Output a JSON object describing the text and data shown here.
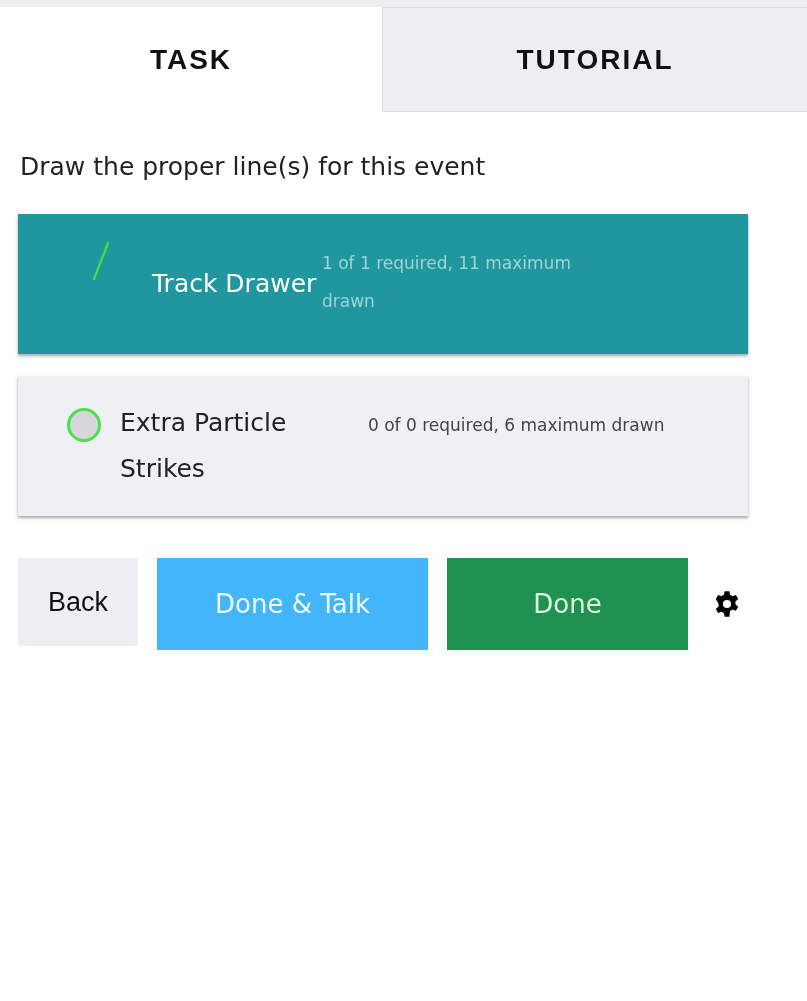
{
  "tabs": [
    {
      "label": "TASK",
      "selected": true
    },
    {
      "label": "TUTORIAL",
      "selected": false
    }
  ],
  "instruction": "Draw the proper line(s) for this event",
  "tools": [
    {
      "kind": "line",
      "label": "Track Drawer",
      "details": "1 of 1 required, 11 maximum drawn",
      "selected": true,
      "color": "#3ee13e"
    },
    {
      "kind": "point",
      "label": "Extra Particle Strikes",
      "details": "0 of 0 required, 6 maximum drawn",
      "selected": false,
      "color": "#4be04b"
    }
  ],
  "buttons": [
    {
      "kind": "back",
      "label": "Back"
    },
    {
      "kind": "talk",
      "label": "Done & Talk"
    },
    {
      "kind": "done",
      "label": "Done"
    }
  ]
}
